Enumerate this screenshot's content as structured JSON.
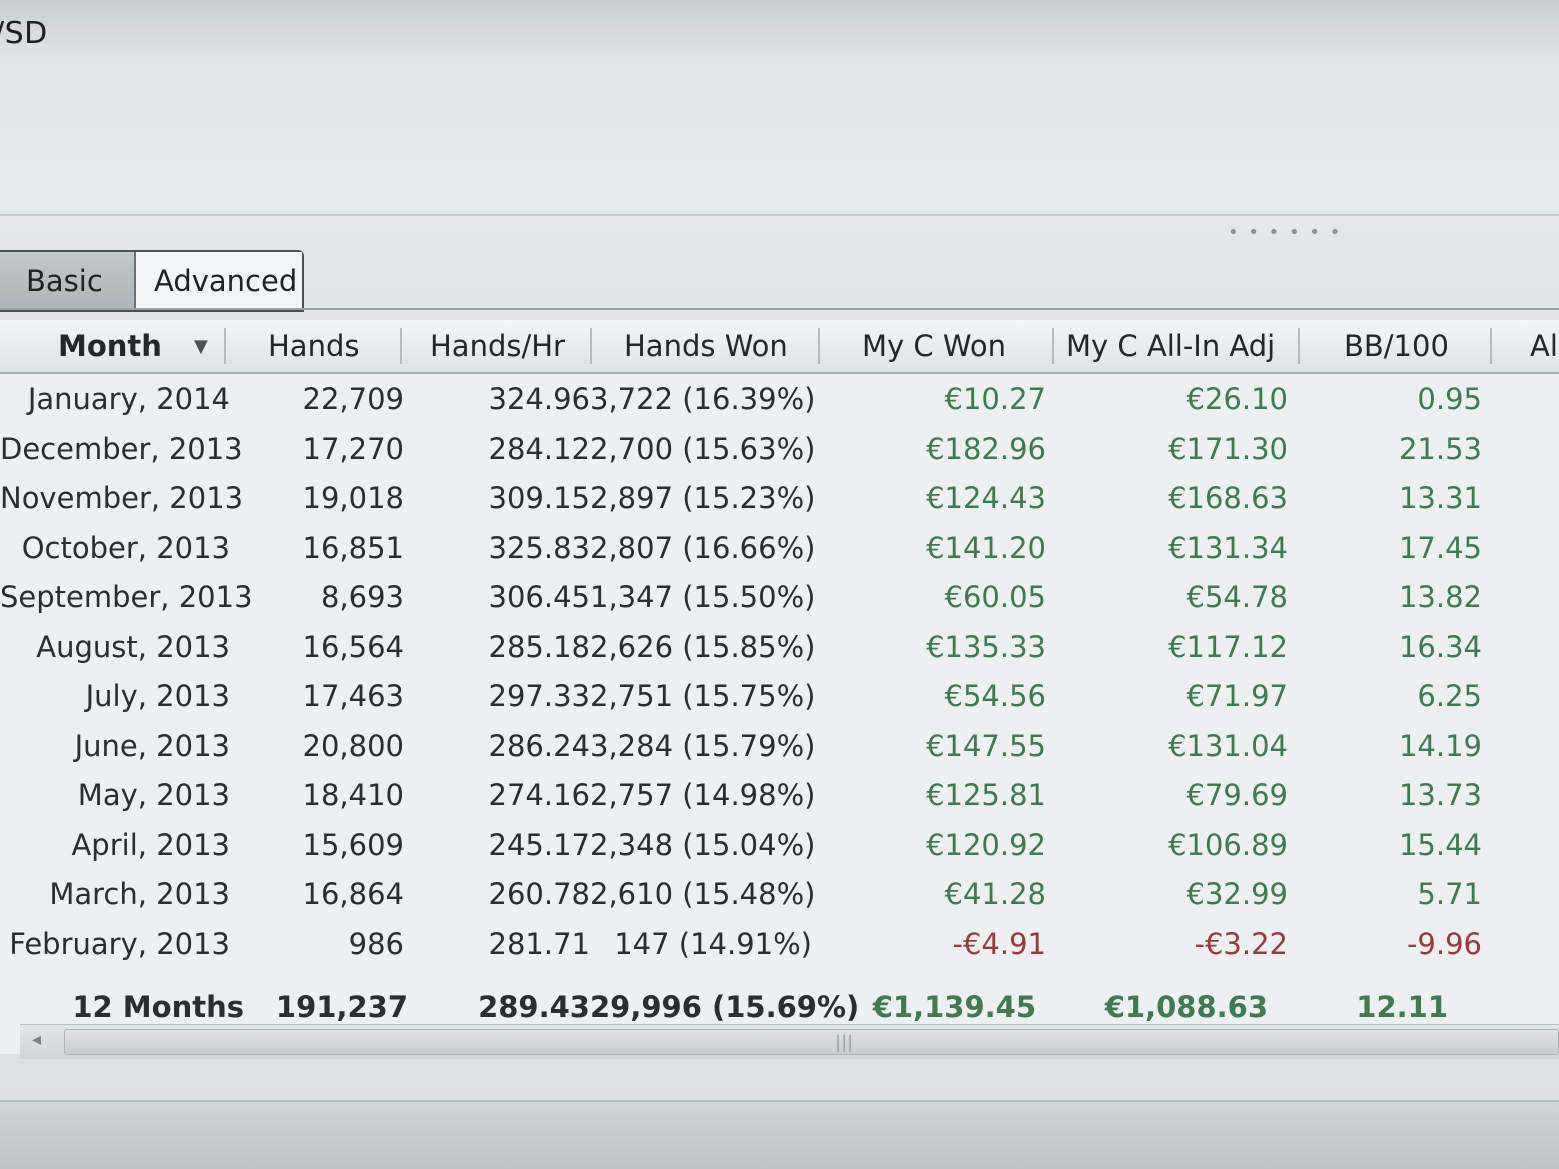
{
  "window": {
    "title_fragment": "/SD"
  },
  "tabs": [
    {
      "label": "Basic",
      "selected": true
    },
    {
      "label": "Advanced",
      "selected": false
    }
  ],
  "columns": [
    "Month",
    "Hands",
    "Hands/Hr",
    "Hands Won",
    "My C Won",
    "My C All-In Adj",
    "BB/100",
    "Al"
  ],
  "sort": {
    "column": "Month",
    "direction": "descending"
  },
  "rows": [
    {
      "month": "January, 2014",
      "hands": "22,709",
      "hands_hr": "324.96",
      "hands_won": "3,722 (16.39%)",
      "won": "€10.27",
      "allin": "€26.10",
      "bb100": "0.95",
      "sign": "pos"
    },
    {
      "month": "December, 2013",
      "hands": "17,270",
      "hands_hr": "284.12",
      "hands_won": "2,700 (15.63%)",
      "won": "€182.96",
      "allin": "€171.30",
      "bb100": "21.53",
      "sign": "pos"
    },
    {
      "month": "November, 2013",
      "hands": "19,018",
      "hands_hr": "309.15",
      "hands_won": "2,897 (15.23%)",
      "won": "€124.43",
      "allin": "€168.63",
      "bb100": "13.31",
      "sign": "pos"
    },
    {
      "month": "October, 2013",
      "hands": "16,851",
      "hands_hr": "325.83",
      "hands_won": "2,807 (16.66%)",
      "won": "€141.20",
      "allin": "€131.34",
      "bb100": "17.45",
      "sign": "pos"
    },
    {
      "month": "September, 2013",
      "hands": "8,693",
      "hands_hr": "306.45",
      "hands_won": "1,347 (15.50%)",
      "won": "€60.05",
      "allin": "€54.78",
      "bb100": "13.82",
      "sign": "pos"
    },
    {
      "month": "August, 2013",
      "hands": "16,564",
      "hands_hr": "285.18",
      "hands_won": "2,626 (15.85%)",
      "won": "€135.33",
      "allin": "€117.12",
      "bb100": "16.34",
      "sign": "pos"
    },
    {
      "month": "July, 2013",
      "hands": "17,463",
      "hands_hr": "297.33",
      "hands_won": "2,751 (15.75%)",
      "won": "€54.56",
      "allin": "€71.97",
      "bb100": "6.25",
      "sign": "pos"
    },
    {
      "month": "June, 2013",
      "hands": "20,800",
      "hands_hr": "286.24",
      "hands_won": "3,284 (15.79%)",
      "won": "€147.55",
      "allin": "€131.04",
      "bb100": "14.19",
      "sign": "pos"
    },
    {
      "month": "May, 2013",
      "hands": "18,410",
      "hands_hr": "274.16",
      "hands_won": "2,757 (14.98%)",
      "won": "€125.81",
      "allin": "€79.69",
      "bb100": "13.73",
      "sign": "pos"
    },
    {
      "month": "April, 2013",
      "hands": "15,609",
      "hands_hr": "245.17",
      "hands_won": "2,348 (15.04%)",
      "won": "€120.92",
      "allin": "€106.89",
      "bb100": "15.44",
      "sign": "pos"
    },
    {
      "month": "March, 2013",
      "hands": "16,864",
      "hands_hr": "260.78",
      "hands_won": "2,610 (15.48%)",
      "won": "€41.28",
      "allin": "€32.99",
      "bb100": "5.71",
      "sign": "pos"
    },
    {
      "month": "February, 2013",
      "hands": "986",
      "hands_hr": "281.71",
      "hands_won": "147 (14.91%)",
      "won": "-€4.91",
      "allin": "-€3.22",
      "bb100": "-9.96",
      "sign": "neg"
    }
  ],
  "totals": {
    "month": "12 Months",
    "hands": "191,237",
    "hands_hr": "289.43",
    "hands_won": "29,996 (15.69%)",
    "won": "€1,139.45",
    "allin": "€1,088.63",
    "bb100": "12.11"
  },
  "colors": {
    "positive": "#3f7a52",
    "negative": "#9a3a40",
    "text": "#2a2e33"
  },
  "icons": {
    "sort": "chevron-down-icon",
    "scroll_left": "arrow-left-icon",
    "scroll_grip": "grip-icon",
    "splitter_grip": "grip-dots-icon"
  }
}
